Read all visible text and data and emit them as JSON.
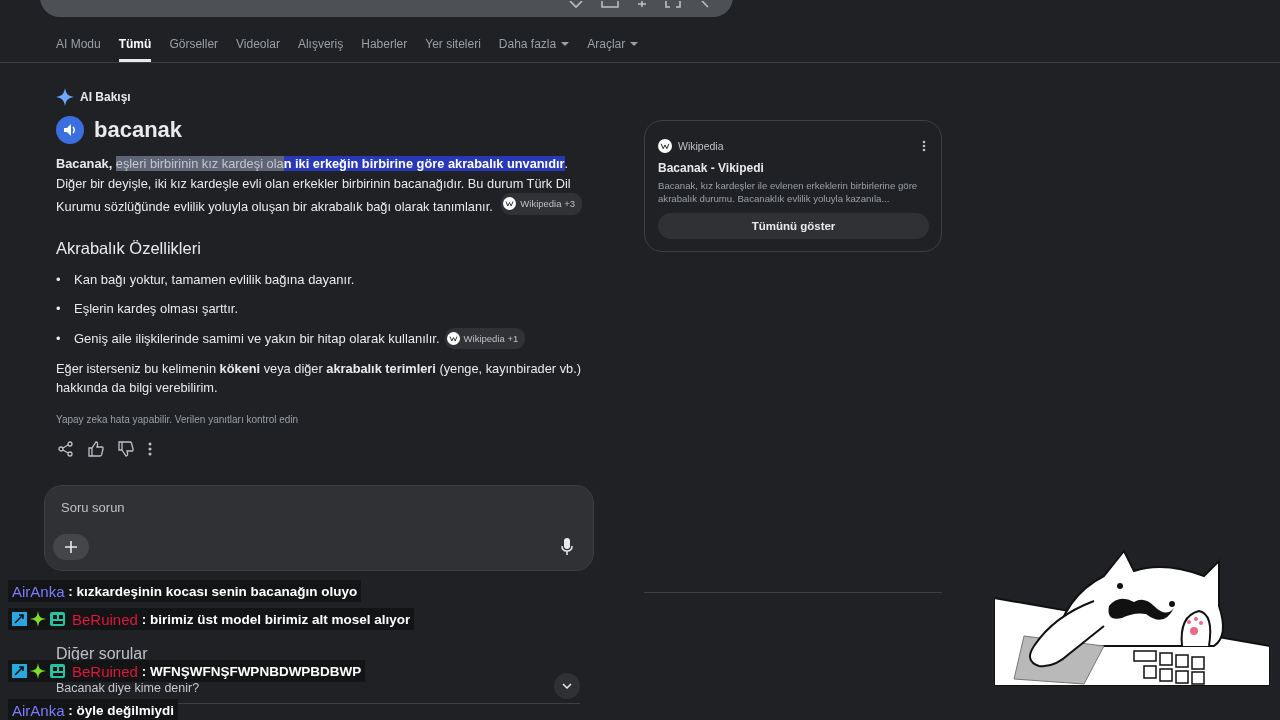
{
  "tabs": [
    {
      "label": "AI Modu",
      "selected": false,
      "dropdown": false
    },
    {
      "label": "Tümü",
      "selected": true,
      "dropdown": false
    },
    {
      "label": "Görseller",
      "selected": false,
      "dropdown": false
    },
    {
      "label": "Videolar",
      "selected": false,
      "dropdown": false
    },
    {
      "label": "Alışveriş",
      "selected": false,
      "dropdown": false
    },
    {
      "label": "Haberler",
      "selected": false,
      "dropdown": false
    },
    {
      "label": "Yer siteleri",
      "selected": false,
      "dropdown": false
    },
    {
      "label": "Daha fazla",
      "selected": false,
      "dropdown": true
    },
    {
      "label": "Araçlar",
      "selected": false,
      "dropdown": true
    }
  ],
  "ai_overview": {
    "label": "AI Bakışı",
    "term": "bacanak",
    "paragraph": [
      {
        "text": "Bacanak, ",
        "bold": true,
        "selected": false,
        "highlighted": false
      },
      {
        "text": "eşleri birbirinin kız kardeşi ola",
        "bold": false,
        "selected": true,
        "highlighted": false
      },
      {
        "text": "n iki erkeğin birbirine göre akrabalık unvanıdır",
        "bold": true,
        "selected": false,
        "highlighted": true
      },
      {
        "text": ". Diğer bir deyişle, iki kız kardeşle evli olan erkekler birbirinin bacanağıdır. Bu durum Türk Dil Kurumu sözlüğünde evlilik yoluyla oluşan bir akrabalık bağı olarak tanımlanır.",
        "bold": false,
        "selected": false,
        "highlighted": false
      }
    ],
    "paragraph_source": "Wikipedia +3",
    "heading": "Akrabalık Özellikleri",
    "bullets": [
      {
        "marker": "•",
        "text": "Kan bağı yoktur, tamamen evlilik bağına dayanır."
      },
      {
        "marker": "•",
        "text": "Eşlerin kardeş olması şarttır."
      },
      {
        "marker": "•",
        "text": "Geniş aile ilişkilerinde samimi ve yakın bir hitap olarak kullanılır.",
        "source": "Wikipedia +1"
      }
    ],
    "closing": "Eğer isterseniz bu kelimenin **kökeni** veya diğer **akrabalık terimleri** (yenge, kayınbirader vb.) hakkında da bilgi verebilirim.",
    "disclaimer": "Yapay zeka hata yapabilir. Verilen yanıtları kontrol edin"
  },
  "ask_box": {
    "placeholder": "Soru sorun"
  },
  "source_card": {
    "site": "Wikipedia",
    "title": "Bacanak - Vikipedi",
    "snippet": "Bacanak, kız kardeşler ile evlenen erkeklerin birbirlerine göre akrabalık durumu. Bacanaklık evlilik yoluyla kazanıla...",
    "button": "Tümünü göster"
  },
  "more_questions": {
    "heading": "Diğer sorular",
    "questions": [
      "Bacanak diye kime denir?"
    ]
  },
  "chat": [
    {
      "user": "AirAnka",
      "color": "#7b7bff",
      "badges": false,
      "message": ": kızkardeşinin kocası senin bacanağın oluyo"
    },
    {
      "user": "BeRuined",
      "color": "#e0163c",
      "badges": true,
      "message": ": birimiz üst model birimiz alt mosel alıyor"
    },
    {
      "user": "BeRuined",
      "color": "#e0163c",
      "badges": true,
      "message": ": WFNŞWFNŞFWPNBDWPBDBWP"
    },
    {
      "user": "AirAnka",
      "color": "#7b7bff",
      "badges": false,
      "message": ": öyle değilmiydi"
    }
  ]
}
